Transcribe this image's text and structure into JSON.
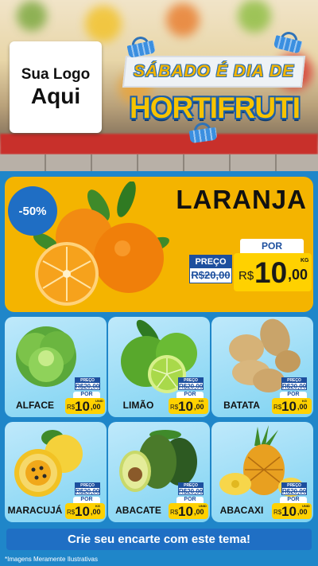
{
  "logo": {
    "line1": "Sua Logo",
    "line2": "Aqui"
  },
  "header": {
    "subtitle": "SÁBADO É DIA DE",
    "title": "HORTIFRUTI"
  },
  "featured": {
    "discount": "-50%",
    "name": "LARANJA",
    "old_label": "PREÇO",
    "old_price": "R$20,00",
    "por_label": "POR",
    "currency": "R$",
    "price_int": "10",
    "price_dec": ",00",
    "unit": "KG"
  },
  "products": [
    {
      "name": "ALFACE",
      "old_label": "PREÇO",
      "old_price": "R$20,00",
      "por_label": "POR",
      "currency": "R$",
      "price_int": "10",
      "price_dec": ",00",
      "unit": "UNID"
    },
    {
      "name": "LIMÃO",
      "old_label": "PREÇO",
      "old_price": "R$20,00",
      "por_label": "POR",
      "currency": "R$",
      "price_int": "10",
      "price_dec": ",00",
      "unit": "KG"
    },
    {
      "name": "BATATA",
      "old_label": "PREÇO",
      "old_price": "R$20,00",
      "por_label": "POR",
      "currency": "R$",
      "price_int": "10",
      "price_dec": ",00",
      "unit": "KG"
    },
    {
      "name": "MARACUJÁ",
      "old_label": "PREÇO",
      "old_price": "R$20,00",
      "por_label": "POR",
      "currency": "R$",
      "price_int": "10",
      "price_dec": ",00",
      "unit": "KG"
    },
    {
      "name": "ABACATE",
      "old_label": "PREÇO",
      "old_price": "R$20,00",
      "por_label": "POR",
      "currency": "R$",
      "price_int": "10",
      "price_dec": ",00",
      "unit": "UNID"
    },
    {
      "name": "ABACAXI",
      "old_label": "PREÇO",
      "old_price": "R$20,00",
      "por_label": "POR",
      "currency": "R$",
      "price_int": "10",
      "price_dec": ",00",
      "unit": "UNID"
    }
  ],
  "cta": "Crie seu encarte com este tema!",
  "disclaimer": "*Imagens Meramente Ilustrativas",
  "colors": {
    "primary_blue": "#1f6fc4",
    "accent_yellow": "#ffd100",
    "feature_bg": "#f4b400"
  }
}
